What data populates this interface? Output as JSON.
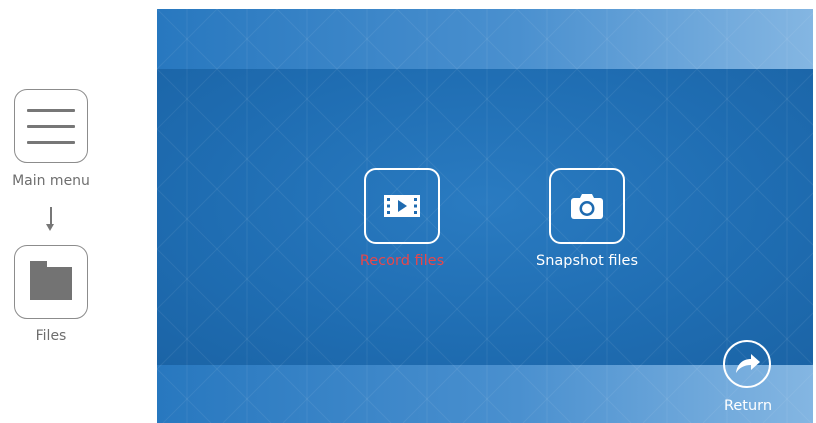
{
  "guide": {
    "main_menu_label": "Main menu",
    "files_label": "Files"
  },
  "screen": {
    "record_files_label": "Record files",
    "snapshot_files_label": "Snapshot files",
    "return_label": "Return"
  },
  "colors": {
    "screen_bg": "#1f6bb0",
    "selected_text": "#e8464a",
    "normal_text": "#ffffff",
    "guide_gray": "#777777"
  },
  "icons": {
    "main_menu": "hamburger-menu-icon",
    "files": "folder-icon",
    "record_files": "video-play-icon",
    "snapshot_files": "camera-icon",
    "return": "return-arrow-icon"
  },
  "state": {
    "selected_item": "Record files"
  }
}
